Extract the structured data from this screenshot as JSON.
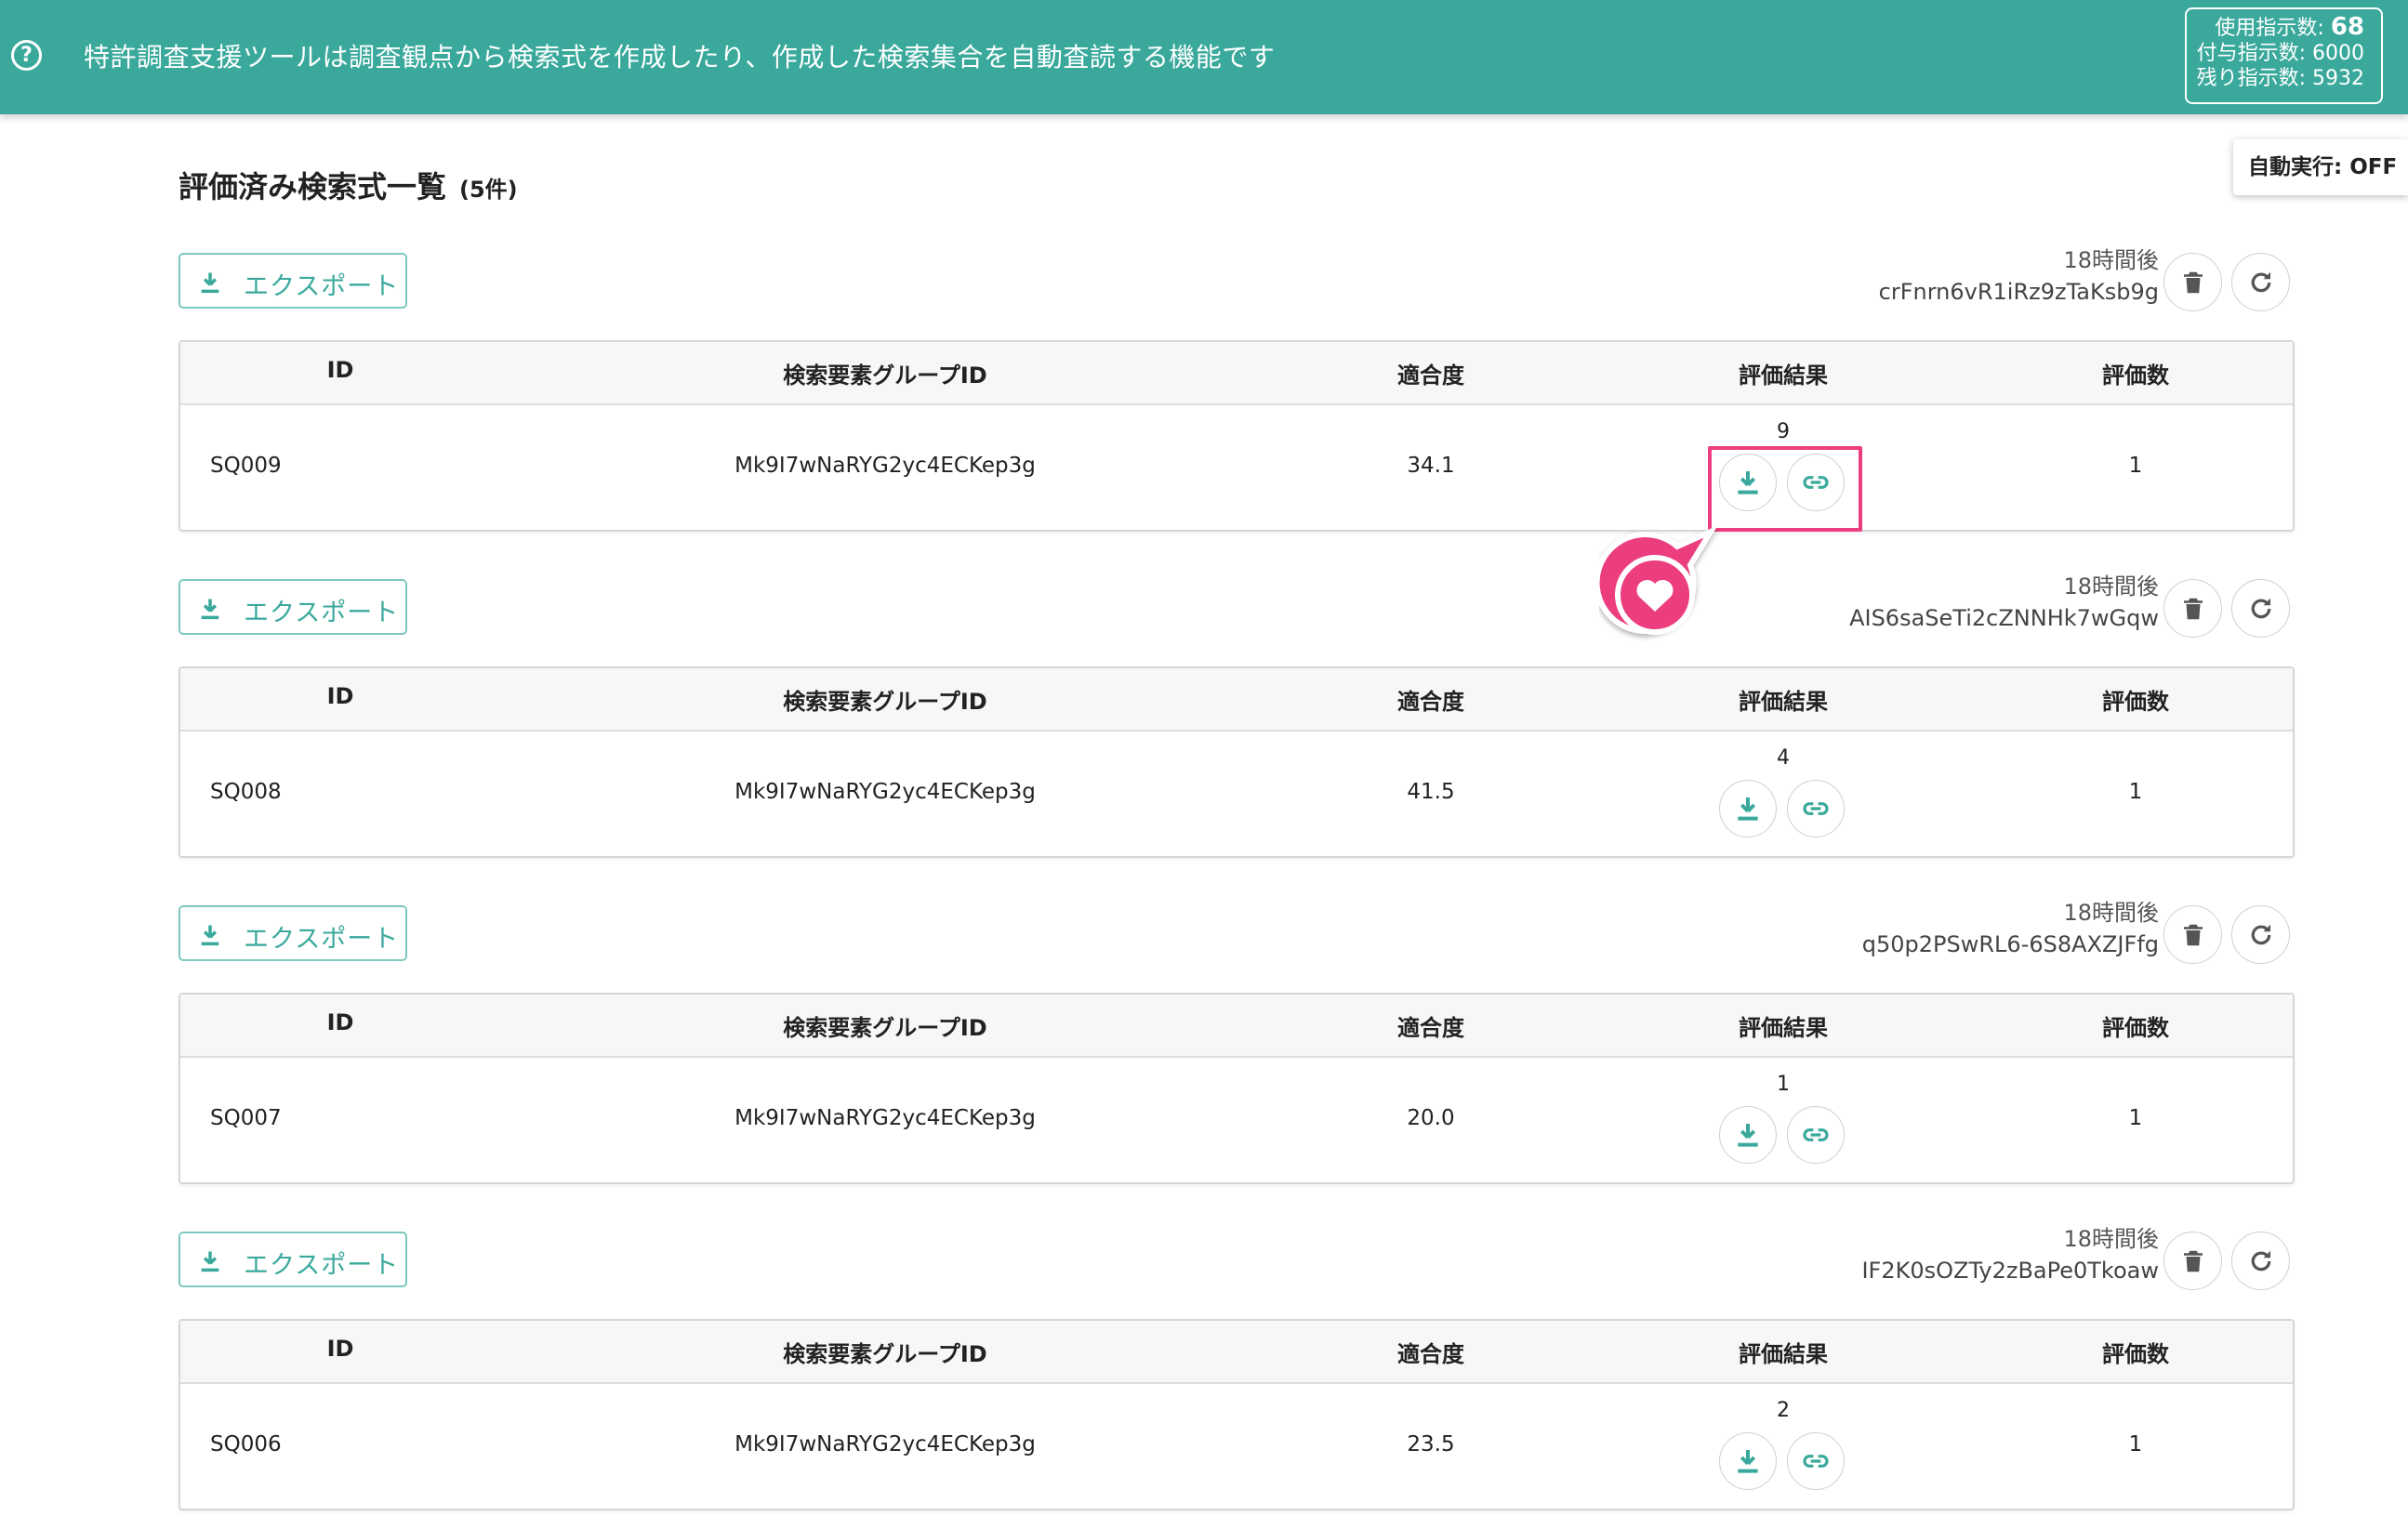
{
  "banner": {
    "help_icon": "question-circle-icon",
    "message": "特許調査支援ツールは調査観点から検索式を作成したり、作成した検索集合を自動査読する機能です",
    "usage": {
      "used_label": "使用指示数:",
      "used_value": "68",
      "granted_label": "付与指示数:",
      "granted_value": "6000",
      "remaining_label": "残り指示数:",
      "remaining_value": "5932"
    }
  },
  "auto_run": "自動実行: OFF",
  "page": {
    "title": "評価済み検索式一覧",
    "count": "(5件)"
  },
  "columns": [
    "ID",
    "検索要素グループID",
    "適合度",
    "評価結果",
    "評価数"
  ],
  "export_label": "エクスポート",
  "sections": [
    {
      "time": "18時間後",
      "hash": "crFnrn6vR1iRz9zTaKsb9g",
      "id": "SQ009",
      "group_id": "Mk9I7wNaRYG2yc4ECKep3g",
      "score": "34.1",
      "result": "9",
      "eval_count": "1"
    },
    {
      "time": "18時間後",
      "hash": "AIS6saSeTi2cZNNHk7wGqw",
      "id": "SQ008",
      "group_id": "Mk9I7wNaRYG2yc4ECKep3g",
      "score": "41.5",
      "result": "4",
      "eval_count": "1"
    },
    {
      "time": "18時間後",
      "hash": "q50p2PSwRL6-6S8AXZJFfg",
      "id": "SQ007",
      "group_id": "Mk9I7wNaRYG2yc4ECKep3g",
      "score": "20.0",
      "result": "1",
      "eval_count": "1"
    },
    {
      "time": "18時間後",
      "hash": "IF2K0sOZTy2zBaPe0Tkoaw",
      "id": "SQ006",
      "group_id": "Mk9I7wNaRYG2yc4ECKep3g",
      "score": "23.5",
      "result": "2",
      "eval_count": "1"
    }
  ],
  "colors": {
    "accent": "#3aa99c",
    "highlight": "#ec3d7f"
  }
}
